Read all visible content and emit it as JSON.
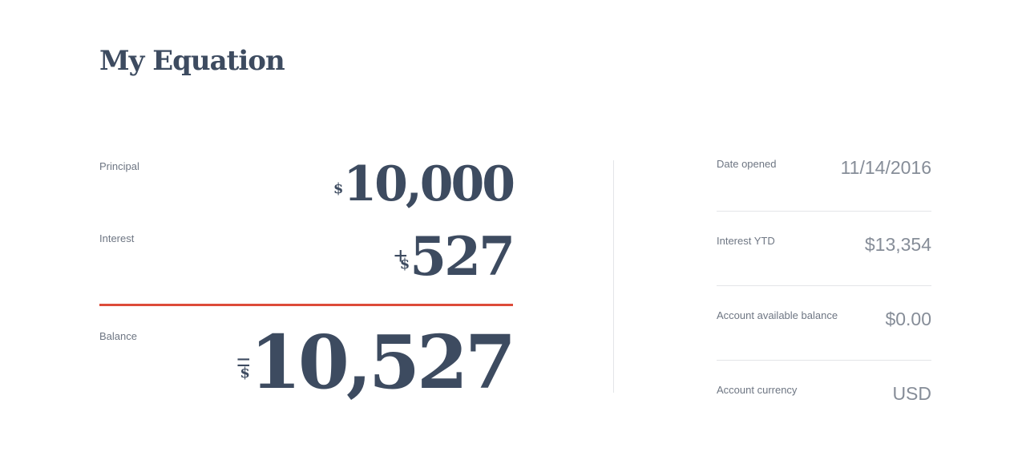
{
  "page": {
    "title": "My Equation"
  },
  "equation": {
    "principal": {
      "label": "Principal",
      "currency_symbol": "$",
      "amount": "10,000"
    },
    "interest": {
      "label": "Interest",
      "operator": "+",
      "currency_symbol": "$",
      "amount": "527"
    },
    "balance": {
      "label": "Balance",
      "operator": "=",
      "currency_symbol": "$",
      "amount": "10,527"
    }
  },
  "details": [
    {
      "label": "Date opened",
      "value": "11/14/2016"
    },
    {
      "label": "Interest YTD",
      "value": "$13,354"
    },
    {
      "label": "Account available balance",
      "value": "$0.00"
    },
    {
      "label": "Account currency",
      "value": "USD"
    }
  ],
  "colors": {
    "text_primary": "#3d4b60",
    "text_muted": "#6e7683",
    "value_muted": "#868d98",
    "accent_rule": "#dd4b39",
    "separator": "#e3e5e8"
  }
}
